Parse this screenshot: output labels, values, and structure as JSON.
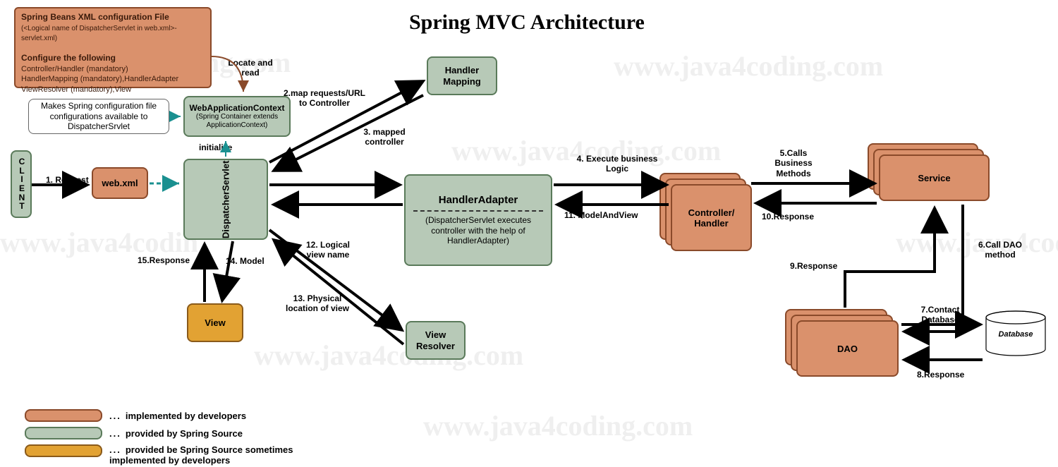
{
  "title": "Spring MVC Architecture",
  "watermark": "www.java4coding.com",
  "boxes": {
    "client": "C\nL\nI\nE\nN\nT",
    "webxml": "web.xml",
    "dispatcher": "DispatcherServlet",
    "wac_title": "WebApplicationContext",
    "wac_sub": "(Spring Container extends ApplicationContext)",
    "makes": "Makes Spring configuration file configurations available to DispatcherSrvlet",
    "handler_mapping": "Handler Mapping",
    "handler_adapter": "HandlerAdapter",
    "handler_adapter_sub": "(DispatcherServlet executes controller with the help of HandlerAdapter)",
    "controller": "Controller/ Handler",
    "service": "Service",
    "dao": "DAO",
    "database": "Database",
    "view": "View",
    "view_resolver": "View Resolver"
  },
  "info": {
    "t1": "Spring Beans XML configuration File",
    "t1s": "(<Logical name of DispatcherServlet in web.xml>-servlet.xml)",
    "t2": "Configure the following",
    "l1": "Controller/Handler (mandatory)",
    "l2": "HandlerMapping (mandatory),HandlerAdapter",
    "l3": "ViewResolver (mandatory),View"
  },
  "labels": {
    "locate": "Locate and read",
    "initialize": "initialize",
    "s1": "1. Request",
    "s2": "2.map requests/URL to Controller",
    "s3": "3. mapped controller",
    "s4": "4. Execute business Logic",
    "s5": "5.Calls Business Methods",
    "s6": "6.Call DAO method",
    "s7": "7.Contact Database",
    "s8": "8.Response",
    "s9": "9.Response",
    "s10": "10.Response",
    "s11": "11. ModelAndView",
    "s12": "12. Logical view name",
    "s13": "13. Physical location of view",
    "s14": "14. Model",
    "s15": "15.Response"
  },
  "legend": {
    "dev": "implemented by developers",
    "spring": "provided by Spring Source",
    "mixed": "provided be Spring Source sometimes implemented by developers"
  }
}
